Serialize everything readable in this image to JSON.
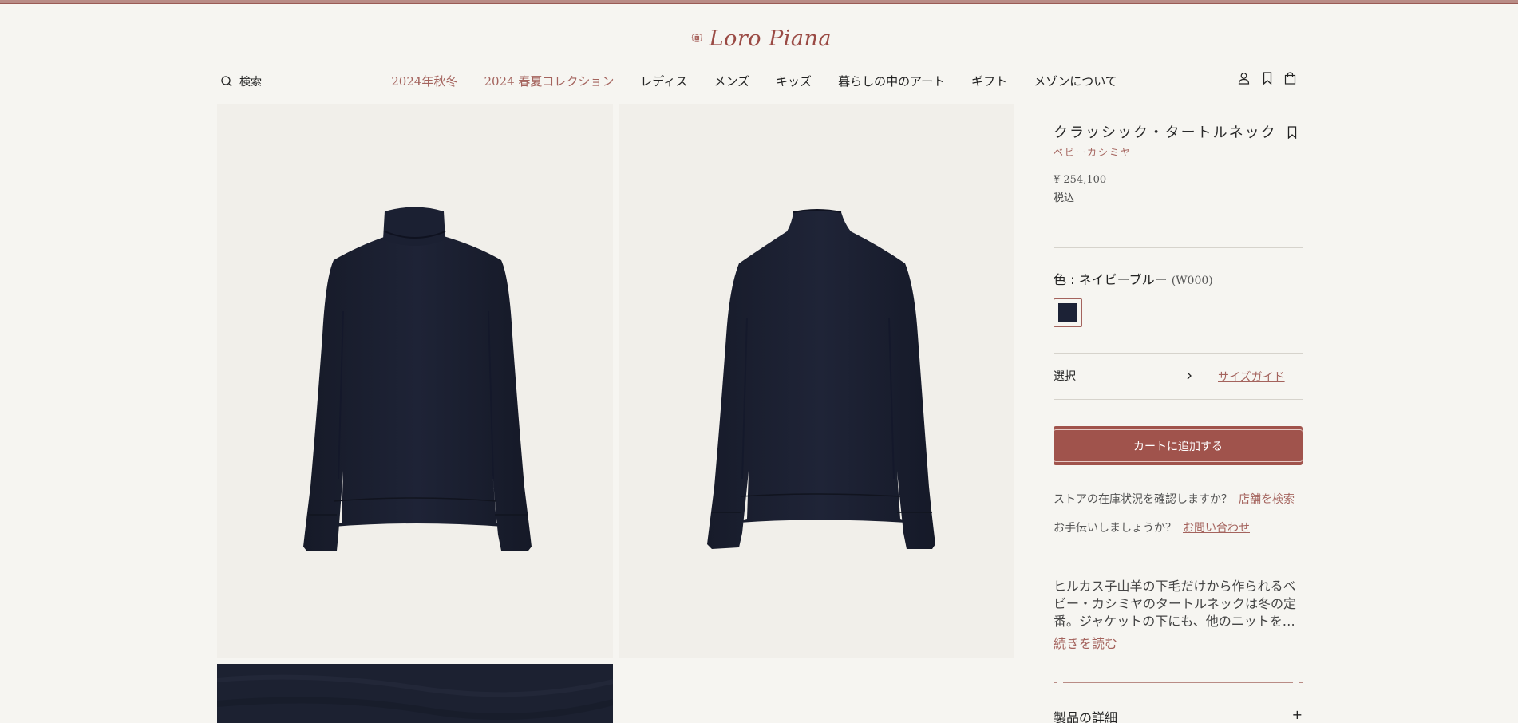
{
  "brand": {
    "name": "Loro Piana",
    "color": "#9a4a44"
  },
  "header": {
    "search_label": "検索",
    "nav": [
      {
        "label": "2024年秋冬",
        "accent": true
      },
      {
        "label": "2024 春夏コレクション",
        "accent": true
      },
      {
        "label": "レディス",
        "accent": false
      },
      {
        "label": "メンズ",
        "accent": false
      },
      {
        "label": "キッズ",
        "accent": false
      },
      {
        "label": "暮らしの中のアート",
        "accent": false
      },
      {
        "label": "ギフト",
        "accent": false
      },
      {
        "label": "メゾンについて",
        "accent": false
      }
    ],
    "icons": [
      "user-icon",
      "bookmark-icon",
      "shopping-bag-icon"
    ]
  },
  "gallery": {
    "images": [
      "turtleneck-front",
      "turtleneck-back",
      "knit-texture-closeup"
    ]
  },
  "product": {
    "title": "クラッシック・タートルネック",
    "material": "ベビーカシミヤ",
    "price": "¥ 254,100",
    "tax_note": "税込",
    "color_label": "色 : ネイビーブルー",
    "color_code": "(W000)",
    "swatch_color": "#1c2236",
    "size_select_label": "選択",
    "size_guide_label": "サイズガイド",
    "add_to_cart_label": "カートに追加する",
    "store_stock_question": "ストアの在庫状況を確認しますか？",
    "store_search_link": "店舗を検索",
    "help_question": "お手伝いしましょうか？",
    "contact_link": "お問い合わせ",
    "description": "ヒルカス子山羊の下毛だけから作られるベビー・カシミヤのタートルネックは冬の定番。ジャケットの下にも、他のニットを…",
    "read_more_label": "続きを読む",
    "details_label": "製品の詳細",
    "details_toggle": "+"
  },
  "colors": {
    "accent": "#a4635d",
    "cart_button": "#a0534c",
    "background": "#f6f5f1"
  }
}
